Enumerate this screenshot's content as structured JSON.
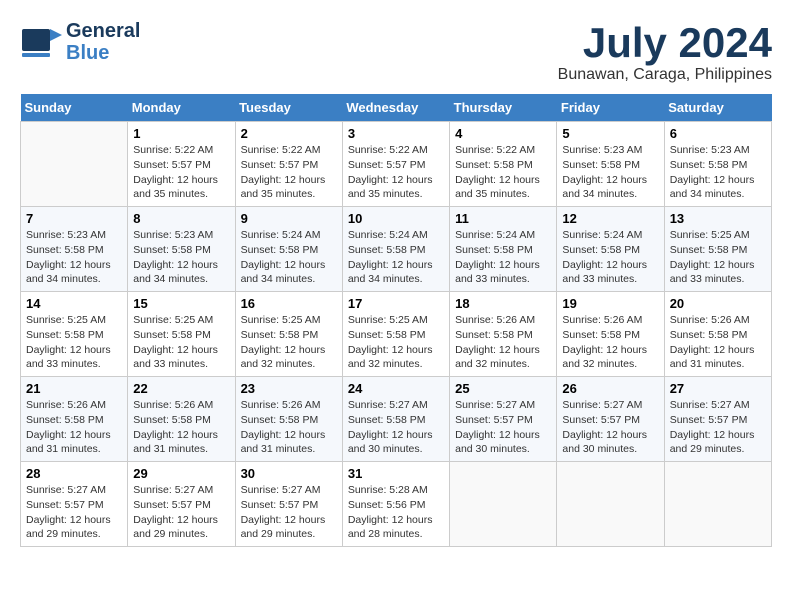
{
  "logo": {
    "line1": "General",
    "line2": "Blue"
  },
  "title": "July 2024",
  "location": "Bunawan, Caraga, Philippines",
  "days_header": [
    "Sunday",
    "Monday",
    "Tuesday",
    "Wednesday",
    "Thursday",
    "Friday",
    "Saturday"
  ],
  "weeks": [
    [
      {
        "day": "",
        "info": ""
      },
      {
        "day": "1",
        "info": "Sunrise: 5:22 AM\nSunset: 5:57 PM\nDaylight: 12 hours\nand 35 minutes."
      },
      {
        "day": "2",
        "info": "Sunrise: 5:22 AM\nSunset: 5:57 PM\nDaylight: 12 hours\nand 35 minutes."
      },
      {
        "day": "3",
        "info": "Sunrise: 5:22 AM\nSunset: 5:57 PM\nDaylight: 12 hours\nand 35 minutes."
      },
      {
        "day": "4",
        "info": "Sunrise: 5:22 AM\nSunset: 5:58 PM\nDaylight: 12 hours\nand 35 minutes."
      },
      {
        "day": "5",
        "info": "Sunrise: 5:23 AM\nSunset: 5:58 PM\nDaylight: 12 hours\nand 34 minutes."
      },
      {
        "day": "6",
        "info": "Sunrise: 5:23 AM\nSunset: 5:58 PM\nDaylight: 12 hours\nand 34 minutes."
      }
    ],
    [
      {
        "day": "7",
        "info": "Sunrise: 5:23 AM\nSunset: 5:58 PM\nDaylight: 12 hours\nand 34 minutes."
      },
      {
        "day": "8",
        "info": "Sunrise: 5:23 AM\nSunset: 5:58 PM\nDaylight: 12 hours\nand 34 minutes."
      },
      {
        "day": "9",
        "info": "Sunrise: 5:24 AM\nSunset: 5:58 PM\nDaylight: 12 hours\nand 34 minutes."
      },
      {
        "day": "10",
        "info": "Sunrise: 5:24 AM\nSunset: 5:58 PM\nDaylight: 12 hours\nand 34 minutes."
      },
      {
        "day": "11",
        "info": "Sunrise: 5:24 AM\nSunset: 5:58 PM\nDaylight: 12 hours\nand 33 minutes."
      },
      {
        "day": "12",
        "info": "Sunrise: 5:24 AM\nSunset: 5:58 PM\nDaylight: 12 hours\nand 33 minutes."
      },
      {
        "day": "13",
        "info": "Sunrise: 5:25 AM\nSunset: 5:58 PM\nDaylight: 12 hours\nand 33 minutes."
      }
    ],
    [
      {
        "day": "14",
        "info": "Sunrise: 5:25 AM\nSunset: 5:58 PM\nDaylight: 12 hours\nand 33 minutes."
      },
      {
        "day": "15",
        "info": "Sunrise: 5:25 AM\nSunset: 5:58 PM\nDaylight: 12 hours\nand 33 minutes."
      },
      {
        "day": "16",
        "info": "Sunrise: 5:25 AM\nSunset: 5:58 PM\nDaylight: 12 hours\nand 32 minutes."
      },
      {
        "day": "17",
        "info": "Sunrise: 5:25 AM\nSunset: 5:58 PM\nDaylight: 12 hours\nand 32 minutes."
      },
      {
        "day": "18",
        "info": "Sunrise: 5:26 AM\nSunset: 5:58 PM\nDaylight: 12 hours\nand 32 minutes."
      },
      {
        "day": "19",
        "info": "Sunrise: 5:26 AM\nSunset: 5:58 PM\nDaylight: 12 hours\nand 32 minutes."
      },
      {
        "day": "20",
        "info": "Sunrise: 5:26 AM\nSunset: 5:58 PM\nDaylight: 12 hours\nand 31 minutes."
      }
    ],
    [
      {
        "day": "21",
        "info": "Sunrise: 5:26 AM\nSunset: 5:58 PM\nDaylight: 12 hours\nand 31 minutes."
      },
      {
        "day": "22",
        "info": "Sunrise: 5:26 AM\nSunset: 5:58 PM\nDaylight: 12 hours\nand 31 minutes."
      },
      {
        "day": "23",
        "info": "Sunrise: 5:26 AM\nSunset: 5:58 PM\nDaylight: 12 hours\nand 31 minutes."
      },
      {
        "day": "24",
        "info": "Sunrise: 5:27 AM\nSunset: 5:58 PM\nDaylight: 12 hours\nand 30 minutes."
      },
      {
        "day": "25",
        "info": "Sunrise: 5:27 AM\nSunset: 5:57 PM\nDaylight: 12 hours\nand 30 minutes."
      },
      {
        "day": "26",
        "info": "Sunrise: 5:27 AM\nSunset: 5:57 PM\nDaylight: 12 hours\nand 30 minutes."
      },
      {
        "day": "27",
        "info": "Sunrise: 5:27 AM\nSunset: 5:57 PM\nDaylight: 12 hours\nand 29 minutes."
      }
    ],
    [
      {
        "day": "28",
        "info": "Sunrise: 5:27 AM\nSunset: 5:57 PM\nDaylight: 12 hours\nand 29 minutes."
      },
      {
        "day": "29",
        "info": "Sunrise: 5:27 AM\nSunset: 5:57 PM\nDaylight: 12 hours\nand 29 minutes."
      },
      {
        "day": "30",
        "info": "Sunrise: 5:27 AM\nSunset: 5:57 PM\nDaylight: 12 hours\nand 29 minutes."
      },
      {
        "day": "31",
        "info": "Sunrise: 5:28 AM\nSunset: 5:56 PM\nDaylight: 12 hours\nand 28 minutes."
      },
      {
        "day": "",
        "info": ""
      },
      {
        "day": "",
        "info": ""
      },
      {
        "day": "",
        "info": ""
      }
    ]
  ]
}
